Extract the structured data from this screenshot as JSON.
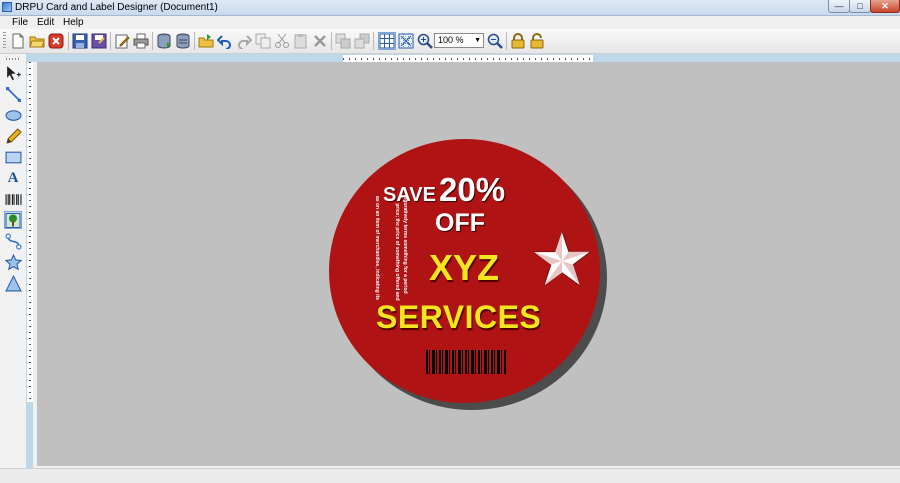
{
  "window": {
    "title": "DRPU Card and Label Designer  (Document1)",
    "controls": {
      "minimize": "—",
      "maximize": "□",
      "close": "✕"
    }
  },
  "menu": {
    "items": [
      "File",
      "Edit",
      "Help"
    ]
  },
  "toolbar": {
    "zoom_value": "100 %",
    "buttons": [
      "new-file-icon",
      "open-folder-icon",
      "close-icon",
      "save-icon",
      "save-as-icon",
      "edit-icon",
      "print-icon",
      "database-icon",
      "database-export-icon",
      "open-icon",
      "undo-icon",
      "redo-icon",
      "copy-icon",
      "cut-icon",
      "paste-icon",
      "delete-icon",
      "bring-front-icon",
      "send-back-icon",
      "grid-icon",
      "grid-snap-icon",
      "zoom-in-icon",
      "zoom-out-icon",
      "lock-icon",
      "unlock-icon"
    ]
  },
  "tools": {
    "text_tool_glyph": "A",
    "items": [
      "pointer-tool-icon",
      "line-tool-icon",
      "ellipse-tool-icon",
      "pencil-tool-icon",
      "rectangle-tool-icon",
      "text-tool-icon",
      "barcode-tool-icon",
      "image-tool-icon",
      "curve-tool-icon",
      "star-tool-icon",
      "triangle-tool-icon"
    ]
  },
  "label": {
    "save_word": "SAVE",
    "percent": "20%",
    "off": "OFF",
    "company": "XYZ",
    "services": "SERVICES",
    "fine_print_1": "as on an item of merchandise, indicating its",
    "fine_print_2": "price; the price of something offered and",
    "fine_print_3": "figuratively terms something for a period",
    "colors": {
      "background": "#b01314",
      "headline": "#ffffff",
      "accent": "#f3e61f"
    }
  }
}
